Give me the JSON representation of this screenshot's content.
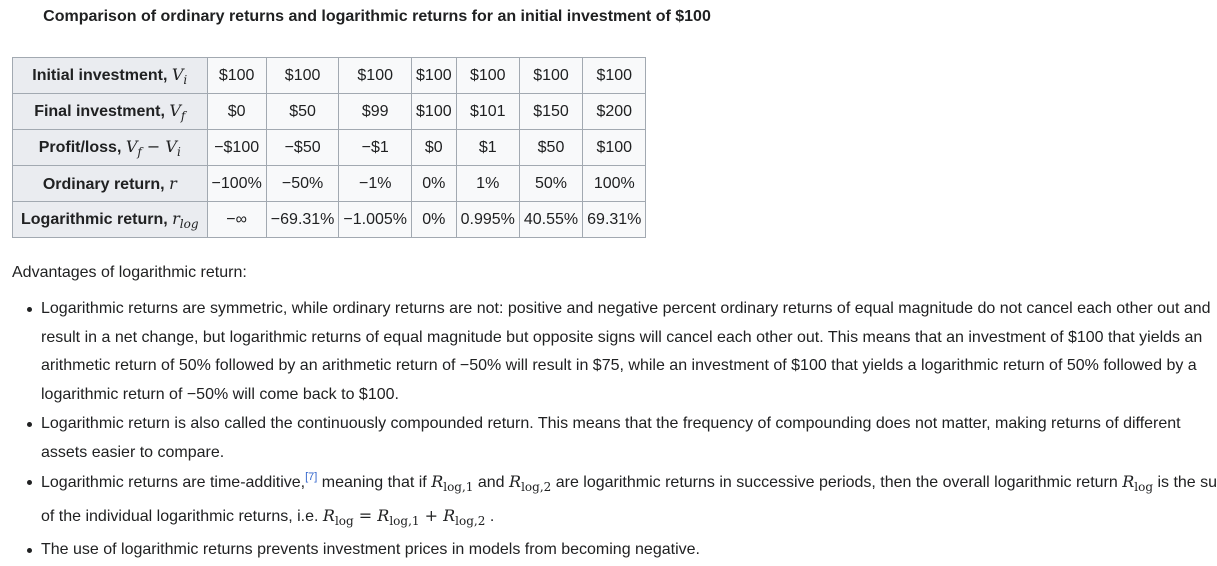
{
  "caption": "Comparison of ordinary returns and logarithmic returns for an initial investment of $100",
  "table": {
    "rows": [
      {
        "label": "Initial investment, ",
        "math": "V",
        "sub": "i",
        "cells": [
          "$100",
          "$100",
          "$100",
          "$100",
          "$100",
          "$100",
          "$100"
        ]
      },
      {
        "label": "Final investment, ",
        "math": "V",
        "sub": "f",
        "cells": [
          "$0",
          "$50",
          "$99",
          "$100",
          "$101",
          "$150",
          "$200"
        ]
      },
      {
        "label": "Profit/loss, ",
        "math": "V",
        "sub": "f",
        "minus": " − ",
        "math2": "V",
        "sub2": "i",
        "cells": [
          "−$100",
          "−$50",
          "−$1",
          "$0",
          "$1",
          "$50",
          "$100"
        ]
      },
      {
        "label": "Ordinary return, ",
        "math": "r",
        "cells": [
          "−100%",
          "−50%",
          "−1%",
          "0%",
          "1%",
          "50%",
          "100%"
        ]
      },
      {
        "label": "Logarithmic return, ",
        "math": "r",
        "sub": "log",
        "cells": [
          "−∞",
          "−69.31%",
          "−1.005%",
          "0%",
          "0.995%",
          "40.55%",
          "69.31%"
        ]
      }
    ]
  },
  "lead": "Advantages of logarithmic return:",
  "bullets": {
    "b1": "Logarithmic returns are symmetric, while ordinary returns are not: positive and negative percent ordinary returns of equal magnitude do not cancel each other out and result in a net change, but logarithmic returns of equal magnitude but opposite signs will cancel each other out. This means that an investment of $100 that yields an arithmetic return of 50% followed by an arithmetic return of −50% will result in $75, while an investment of $100 that yields a logarithmic return of 50% followed by a logarithmic return of −50% will come back to $100.",
    "b2": "Logarithmic return is also called the continuously compounded return. This means that the frequency of compounding does not matter, making returns of different assets easier to compare.",
    "b3": {
      "t1": "Logarithmic returns are time-additive,",
      "ref": "[7]",
      "t2": " meaning that if ",
      "t3": " and ",
      "t4": " are logarithmic returns in successive periods, then the overall logarithmic return ",
      "t5": " is the sum of the individual logarithmic returns, i.e. ",
      "eq": " = ",
      "plus": " + ",
      "end": " .",
      "R": "R",
      "s1": "log,1",
      "s2": "log,2",
      "slog": "log"
    },
    "b4": "The use of logarithmic returns prevents investment prices in models from becoming negative."
  }
}
